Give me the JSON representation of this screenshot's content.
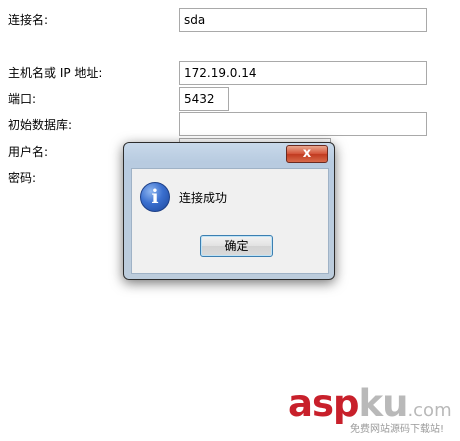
{
  "form": {
    "name_label": "连接名:",
    "name_value": "sda",
    "host_label": "主机名或 IP 地址:",
    "host_value": "172.19.0.14",
    "port_label": "端口:",
    "port_value": "5432",
    "db_label": "初始数据库:",
    "db_value": "",
    "user_label": "用户名:",
    "user_value": "",
    "password_label": "密码:"
  },
  "dialog": {
    "close_symbol": "x",
    "icon_glyph": "i",
    "message": "连接成功",
    "ok_label": "确定"
  },
  "watermark": {
    "logo_red": "asp",
    "logo_gray": "ku",
    "domain": ".com",
    "slogan": "免费网站源码下载站!"
  },
  "colors": {
    "watermark_red": "#c8202b",
    "watermark_gray": "#b9b9b9",
    "close_button": "#c13a1f",
    "dialog_frame": "#b8cbe0"
  }
}
